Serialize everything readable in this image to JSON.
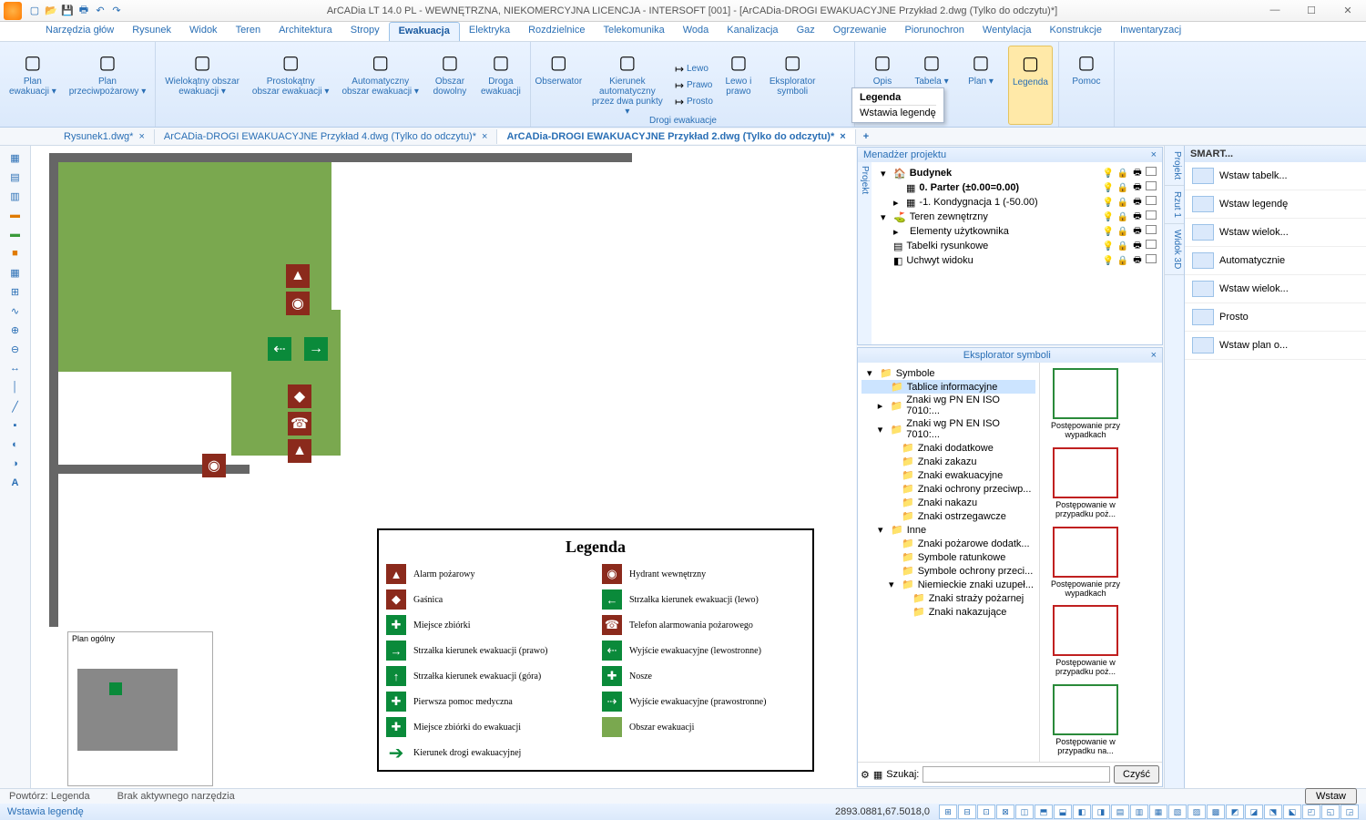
{
  "title": "ArCADia LT 14.0 PL - WEWNĘTRZNA, NIEKOMERCYJNA LICENCJA - INTERSOFT [001] - [ArCADia-DROGI EWAKUACYJNE Przykład 2.dwg (Tylko do odczytu)*]",
  "ribbon_tabs": [
    "Narzędzia głów",
    "Rysunek",
    "Widok",
    "Teren",
    "Architektura",
    "Stropy",
    "Ewakuacja",
    "Elektryka",
    "Rozdzielnice",
    "Telekomunika",
    "Woda",
    "Kanalizacja",
    "Gaz",
    "Ogrzewanie",
    "Piorunochron",
    "Wentylacja",
    "Konstrukcje",
    "Inwentaryzacj"
  ],
  "ribbon_active": 6,
  "ribbon": {
    "group1": {
      "items": [
        {
          "label": "Plan\newakuacji ▾"
        },
        {
          "label": "Plan\nprzeciwpożarowy ▾"
        }
      ]
    },
    "group2": {
      "items": [
        {
          "label": "Wielokątny obszar\newakuacji ▾"
        },
        {
          "label": "Prostokątny\nobszar ewakuacji ▾"
        },
        {
          "label": "Automatyczny\nobszar ewakuacji ▾"
        },
        {
          "label": "Obszar\ndowolny"
        },
        {
          "label": "Droga\newakuacji"
        }
      ]
    },
    "group3": {
      "items": [
        {
          "label": "Obserwator"
        },
        {
          "label": "Kierunek automatyczny\nprzez dwa punkty ▾"
        }
      ],
      "small": [
        {
          "label": "Lewo"
        },
        {
          "label": "Prawo"
        },
        {
          "label": "Prosto"
        }
      ],
      "more": [
        {
          "label": "Lewo i\nprawo"
        },
        {
          "label": "Eksplorator\nsymboli"
        }
      ]
    },
    "group4": {
      "items": [
        {
          "label": "Opis"
        },
        {
          "label": "Tabela ▾"
        },
        {
          "label": "Plan ▾"
        },
        {
          "label": "Legenda"
        }
      ]
    },
    "group5": {
      "items": [
        {
          "label": "Pomoc"
        }
      ]
    },
    "group_label": "Drogi ewakuacje"
  },
  "tooltip": {
    "title": "Legenda",
    "body": "Wstawia legendę"
  },
  "doc_tabs": [
    {
      "label": "Rysunek1.dwg*",
      "active": false
    },
    {
      "label": "ArCADia-DROGI EWAKUACYJNE Przykład 4.dwg (Tylko do odczytu)*",
      "active": false
    },
    {
      "label": "ArCADia-DROGI EWAKUACYJNE Przykład 2.dwg (Tylko do odczytu)*",
      "active": true
    }
  ],
  "legend": {
    "title": "Legenda",
    "items": [
      {
        "color": "#8b2a1c",
        "sym": "▲",
        "label": "Alarm pożarowy"
      },
      {
        "color": "#8b2a1c",
        "sym": "◉",
        "label": "Hydrant wewnętrzny"
      },
      {
        "color": "#8b2a1c",
        "sym": "◆",
        "label": "Gaśnica"
      },
      {
        "color": "#0a8a3a",
        "sym": "←",
        "label": "Strzałka kierunek ewakuacji (lewo)"
      },
      {
        "color": "#0a8a3a",
        "sym": "✚",
        "label": "Miejsce zbiórki"
      },
      {
        "color": "#8b2a1c",
        "sym": "☎",
        "label": "Telefon alarmowania pożarowego"
      },
      {
        "color": "#0a8a3a",
        "sym": "→",
        "label": "Strzałka kierunek ewakuacji (prawo)"
      },
      {
        "color": "#0a8a3a",
        "sym": "⇠",
        "label": "Wyjście ewakuacyjne (lewostronne)"
      },
      {
        "color": "#0a8a3a",
        "sym": "↑",
        "label": "Strzałka kierunek ewakuacji (góra)"
      },
      {
        "color": "#0a8a3a",
        "sym": "✚",
        "label": "Nosze"
      },
      {
        "color": "#0a8a3a",
        "sym": "✚",
        "label": "Pierwsza pomoc medyczna"
      },
      {
        "color": "#0a8a3a",
        "sym": "⇢",
        "label": "Wyjście ewakuacyjne (prawostronne)"
      },
      {
        "color": "#0a8a3a",
        "sym": "✚",
        "label": "Miejsce zbiórki do ewakuacji"
      },
      {
        "color": "#7aa84f",
        "sym": "",
        "label": "Obszar ewakuacji"
      },
      {
        "color": "#0a8a3a",
        "sym": "➔",
        "label": "Kierunek drogi ewakuacyjnej",
        "arrow": true
      }
    ]
  },
  "overview_title": "Plan ogólny",
  "project_panel": {
    "title": "Menadżer projektu",
    "rows": [
      {
        "indent": 0,
        "exp": "▾",
        "icon": "🏠",
        "label": "Budynek",
        "bold": true
      },
      {
        "indent": 1,
        "exp": "",
        "icon": "▦",
        "label": "0. Parter (±0.00=0.00)",
        "bold": true
      },
      {
        "indent": 1,
        "exp": "▸",
        "icon": "▦",
        "label": "-1. Kondygnacja 1 (-50.00)"
      },
      {
        "indent": 0,
        "exp": "▾",
        "icon": "⛳",
        "label": "Teren zewnętrzny"
      },
      {
        "indent": 1,
        "exp": "▸",
        "icon": "",
        "label": "Elementy użytkownika"
      },
      {
        "indent": 0,
        "exp": "",
        "icon": "▤",
        "label": "Tabelki rysunkowe"
      },
      {
        "indent": 0,
        "exp": "",
        "icon": "◧",
        "label": "Uchwyt widoku"
      }
    ]
  },
  "side_tabs": [
    "Projekt",
    "Rzut 1",
    "Widok 3D"
  ],
  "smart": {
    "title": "SMART...",
    "items": [
      {
        "label": "Wstaw tabelk..."
      },
      {
        "label": "Wstaw legendę"
      },
      {
        "label": "Wstaw wielok..."
      },
      {
        "label": "Automatycznie"
      },
      {
        "label": "Wstaw wielok..."
      },
      {
        "label": "Prosto"
      },
      {
        "label": "Wstaw plan o..."
      }
    ]
  },
  "explorer": {
    "title": "Eksplorator symboli",
    "tree": [
      {
        "indent": 0,
        "exp": "▾",
        "label": "Symbole"
      },
      {
        "indent": 1,
        "sel": true,
        "label": "Tablice informacyjne"
      },
      {
        "indent": 1,
        "exp": "▸",
        "label": "Znaki wg PN EN ISO 7010:..."
      },
      {
        "indent": 1,
        "exp": "▾",
        "label": "Znaki wg PN EN ISO 7010:..."
      },
      {
        "indent": 2,
        "label": "Znaki dodatkowe"
      },
      {
        "indent": 2,
        "label": "Znaki zakazu"
      },
      {
        "indent": 2,
        "label": "Znaki ewakuacyjne"
      },
      {
        "indent": 2,
        "label": "Znaki ochrony przeciwp..."
      },
      {
        "indent": 2,
        "label": "Znaki nakazu"
      },
      {
        "indent": 2,
        "label": "Znaki ostrzegawcze"
      },
      {
        "indent": 1,
        "exp": "▾",
        "label": "Inne"
      },
      {
        "indent": 2,
        "label": "Znaki pożarowe dodatk..."
      },
      {
        "indent": 2,
        "label": "Symbole ratunkowe"
      },
      {
        "indent": 2,
        "label": "Symbole ochrony przeci..."
      },
      {
        "indent": 2,
        "exp": "▾",
        "label": "Niemieckie znaki uzupeł..."
      },
      {
        "indent": 3,
        "label": "Znaki straży pożarnej"
      },
      {
        "indent": 3,
        "label": "Znaki nakazujące"
      }
    ],
    "thumbs": [
      {
        "border": "#2a8a3a",
        "label": "Postępowanie przy wypadkach"
      },
      {
        "border": "#c02020",
        "label": "Postępowanie w przypadku poż..."
      },
      {
        "border": "#c02020",
        "label": "Postępowanie przy wypadkach"
      },
      {
        "border": "#c02020",
        "label": "Postępowanie w przypadku poż..."
      },
      {
        "border": "#2a8a3a",
        "label": "Postępowanie w przypadku na..."
      }
    ],
    "search_label": "Szukaj:",
    "clear": "Czyść",
    "insert": "Wstaw"
  },
  "status": {
    "repeat": "Powtórz: Legenda",
    "tool": "Brak aktywnego narzędzia",
    "hint": "Wstawia legendę",
    "coords": "2893.0881,67.5018,0"
  }
}
